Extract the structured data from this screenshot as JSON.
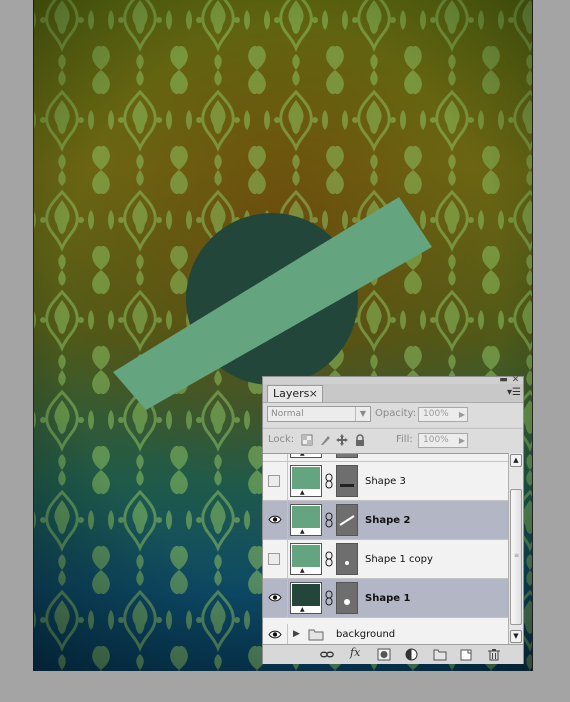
{
  "canvas": {
    "colors": {
      "circle": "#22463a",
      "bar": "#64a47e",
      "damask": "#8cc060"
    }
  },
  "layers_panel": {
    "tab_label": "Layers",
    "tab_close": "×",
    "menu_icon": "panel-menu-icon",
    "blend_mode": "Normal",
    "opacity_label": "Opacity:",
    "opacity_value": "100%",
    "lock_label": "Lock:",
    "fill_label": "Fill:",
    "fill_value": "100%",
    "layers": [
      {
        "name": "Shape 3",
        "visible": false,
        "selected": false,
        "thumb_color": "#64a47e",
        "mask": "horizontal-bar"
      },
      {
        "name": "Shape 2",
        "visible": true,
        "selected": true,
        "thumb_color": "#64a47e",
        "mask": "diagonal-line"
      },
      {
        "name": "Shape 1 copy",
        "visible": false,
        "selected": false,
        "thumb_color": "#64a47e",
        "mask": "dot"
      },
      {
        "name": "Shape 1",
        "visible": true,
        "selected": true,
        "thumb_color": "#22463a",
        "mask": "dot"
      }
    ],
    "group": {
      "name": "background",
      "visible": true
    },
    "bottom_icons": [
      "link-layers-icon",
      "fx-icon",
      "add-mask-icon",
      "adjustment-layer-icon",
      "new-group-icon",
      "new-layer-icon",
      "trash-icon"
    ],
    "fx_label": "fx"
  }
}
